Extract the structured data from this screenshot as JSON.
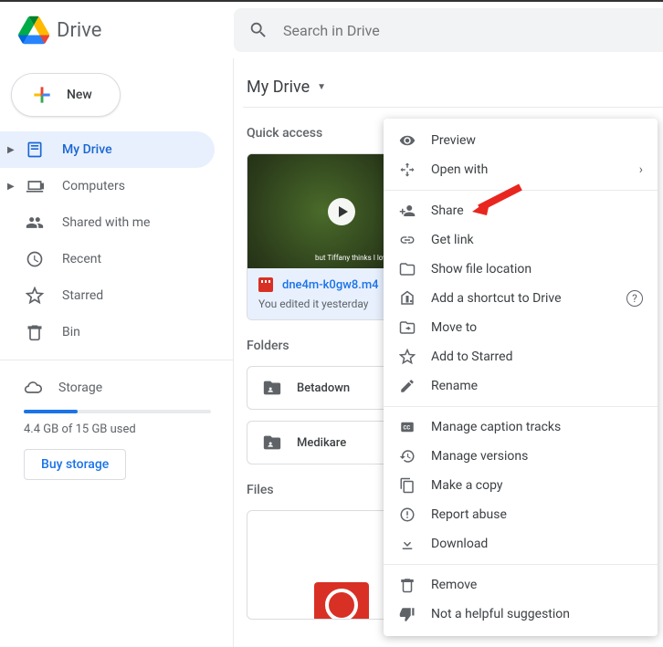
{
  "app": {
    "name": "Drive"
  },
  "search": {
    "placeholder": "Search in Drive"
  },
  "new_button": "New",
  "nav": {
    "my_drive": "My Drive",
    "computers": "Computers",
    "shared": "Shared with me",
    "recent": "Recent",
    "starred": "Starred",
    "bin": "Bin",
    "storage": "Storage"
  },
  "storage": {
    "used_text": "4.4 GB of 15 GB used",
    "buy": "Buy storage"
  },
  "crumb": "My Drive",
  "sections": {
    "quick": "Quick access",
    "folders": "Folders",
    "files": "Files"
  },
  "quick_file": {
    "name": "dne4m-k0gw8.m4",
    "sub": "You edited it yesterday",
    "thumb_caption": "but Tiffany thinks\nI love her so goo"
  },
  "folders": [
    {
      "name": "Betadown"
    },
    {
      "name": "Medikare"
    }
  ],
  "ctx": {
    "preview": "Preview",
    "open_with": "Open with",
    "share": "Share",
    "get_link": "Get link",
    "show_loc": "Show file location",
    "shortcut": "Add a shortcut to Drive",
    "move": "Move to",
    "star": "Add to Starred",
    "rename": "Rename",
    "captions": "Manage caption tracks",
    "versions": "Manage versions",
    "copy": "Make a copy",
    "abuse": "Report abuse",
    "download": "Download",
    "remove": "Remove",
    "not_helpful": "Not a helpful suggestion"
  }
}
